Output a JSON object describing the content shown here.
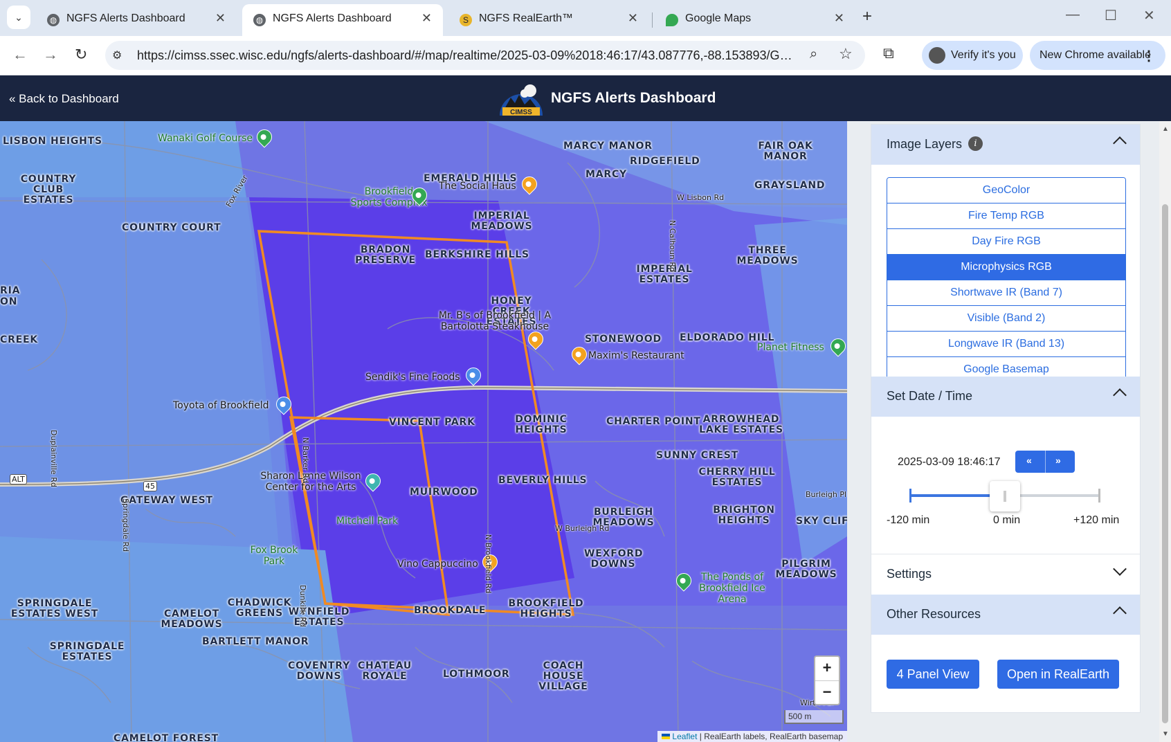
{
  "browser": {
    "tabs": [
      {
        "title": "NGFS Alerts Dashboard",
        "active": false
      },
      {
        "title": "NGFS Alerts Dashboard",
        "active": true
      },
      {
        "title": "NGFS RealEarth™",
        "active": false
      },
      {
        "title": "Google Maps",
        "active": false
      }
    ],
    "url": "https://cimss.ssec.wisc.edu/ngfs/alerts-dashboard/#/map/realtime/2025-03-09%2018:46:17/43.087776,-88.153893/GOES-...",
    "verify_label": "Verify it's you",
    "update_label": "New Chrome available"
  },
  "app": {
    "back_label": "« Back to Dashboard",
    "logo_text": "CIMSS",
    "title": "NGFS Alerts Dashboard"
  },
  "map": {
    "places": [
      "LISBON HEIGHTS",
      "COUNTRY CLUB ESTATES",
      "COUNTRY COURT",
      "EMERALD HILLS",
      "IMPERIAL MEADOWS",
      "BRADON PRESERVE",
      "BERKSHIRE HILLS",
      "MARCY MANOR",
      "RIDGEFIELD",
      "MARCY",
      "FAIR OAK MANOR",
      "GRAYSLAND",
      "THREE MEADOWS",
      "IMPERIAL ESTATES",
      "HONEY CREEK ESTATES",
      "STONEWOOD",
      "ELDORADO HILL",
      "VINCENT PARK",
      "DOMINIC HEIGHTS",
      "CHARTER POINT",
      "ARROWHEAD LAKE ESTATES",
      "SUNNY CREST",
      "CHERRY HILL ESTATES",
      "BEVERLY HILLS",
      "MUIRWOOD",
      "GATEWAY WEST",
      "BURLEIGH MEADOWS",
      "BRIGHTON HEIGHTS",
      "SKY CLIFF",
      "WEXFORD DOWNS",
      "PILGRIM MEADOWS",
      "CHADWICK GREENS",
      "WYNFIELD ESTATES",
      "SPRINGDALE ESTATES WEST",
      "CAMELOT MEADOWS",
      "BROOKDALE",
      "BROOKFIELD HEIGHTS",
      "BARTLETT MANOR",
      "SPRINGDALE ESTATES",
      "COVENTRY DOWNS",
      "CHATEAU ROYALE",
      "LOTHMOOR",
      "COACH HOUSE VILLAGE",
      "CAMELOT FOREST",
      "CREEK",
      "RIA",
      "ON"
    ],
    "pois": [
      "Wanaki Golf Course",
      "Brookfield Sports Complex",
      "The Social Haus",
      "Mr. B's of Brookfield | A Bartolotta Steakhouse",
      "Maxim's Restaurant",
      "Planet Fitness",
      "Sendik's Fine Foods",
      "Toyota of Brookfield",
      "Sharon Lynne Wilson Center for the Arts",
      "Mitchell Park",
      "Fox Brook Park",
      "Vino Cappuccino",
      "The Ponds of Brookfield Ice Arena"
    ],
    "roads": [
      "W Lisbon Rd",
      "N Calhoun Rd",
      "N Barker Rd",
      "N Brookfield Rd",
      "W Burleigh Rd",
      "Burleigh Pl",
      "Springdale Rd",
      "Dunkirk Rd",
      "Fox River",
      "Duplainville Rd",
      "Wirth Par"
    ],
    "shields": [
      "45",
      "ALT 45",
      "ALT"
    ],
    "zoom_in": "+",
    "zoom_out": "−",
    "scale": "500 m",
    "attribution_leaflet": "Leaflet",
    "attribution_rest": " | RealEarth labels, RealEarth basemap"
  },
  "panel": {
    "image_layers": {
      "title": "Image Layers",
      "info_icon": "i",
      "expanded": true,
      "layers": [
        "GeoColor",
        "Fire Temp RGB",
        "Day Fire RGB",
        "Microphysics RGB",
        "Shortwave IR (Band 7)",
        "Visible (Band 2)",
        "Longwave IR (Band 13)",
        "Google Basemap"
      ],
      "selected": "Microphysics RGB"
    },
    "date_time": {
      "title": "Set Date / Time",
      "expanded": true,
      "value": "2025-03-09 18:46:17",
      "prev_label": "«",
      "next_label": "»",
      "slider_min_label": "-120 min",
      "slider_mid_label": "0 min",
      "slider_max_label": "+120 min",
      "slider_value_fraction": 0.5
    },
    "settings": {
      "title": "Settings",
      "expanded": false
    },
    "other_resources": {
      "title": "Other Resources",
      "expanded": true,
      "buttons": [
        "4 Panel View",
        "Open in RealEarth"
      ]
    }
  },
  "colors": {
    "appbar": "#1a2540",
    "accent": "#2f6be4",
    "alert_polygon": "#f08a24",
    "overlay_dark": "#5b3ee8"
  }
}
